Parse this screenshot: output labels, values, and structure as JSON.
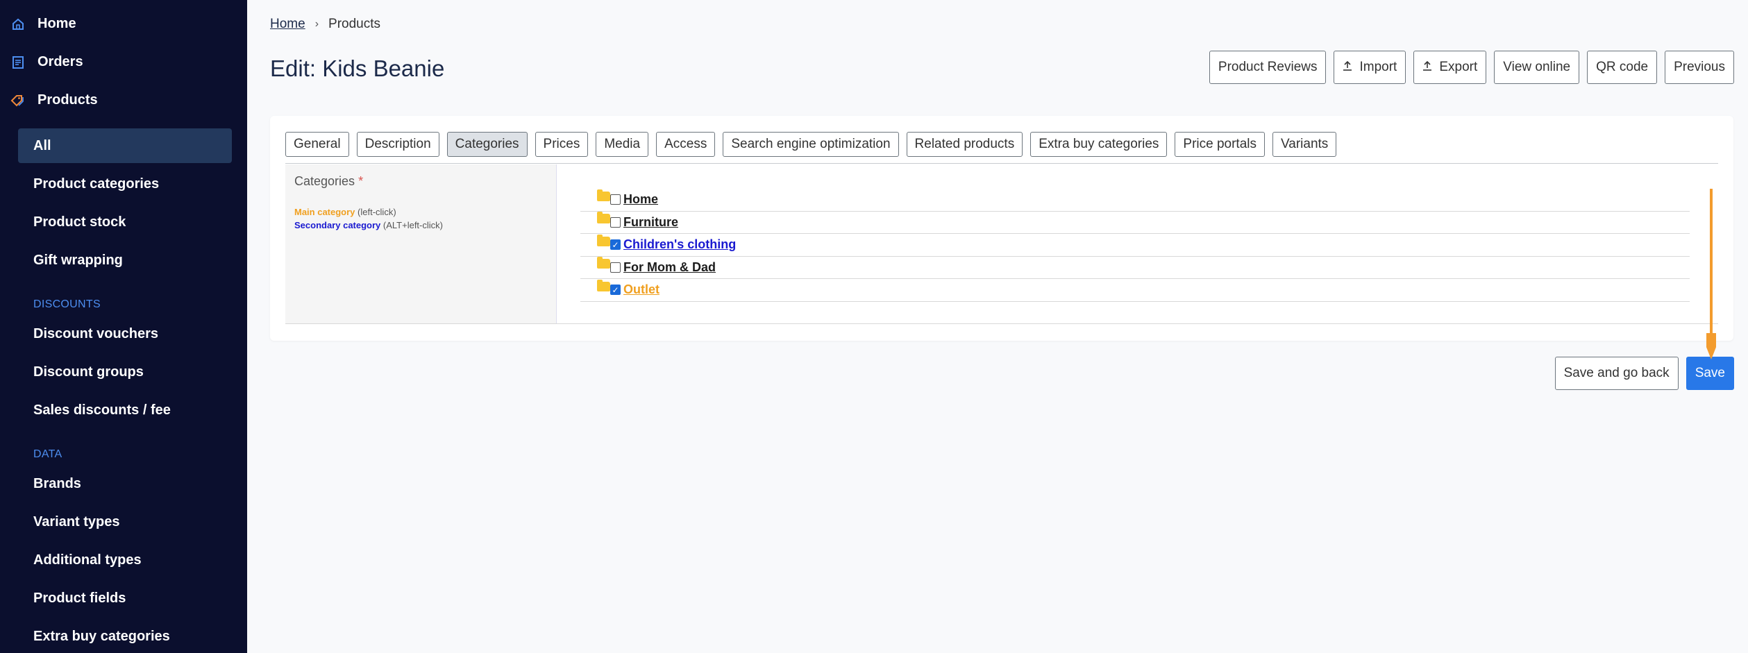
{
  "sidebar": {
    "top": [
      {
        "label": "Home",
        "icon": "home-icon"
      },
      {
        "label": "Orders",
        "icon": "orders-icon"
      },
      {
        "label": "Products",
        "icon": "tag-icon"
      }
    ],
    "products_sub": [
      "All",
      "Product categories",
      "Product stock",
      "Gift wrapping"
    ],
    "discounts_heading": "DISCOUNTS",
    "discounts": [
      "Discount vouchers",
      "Discount groups",
      "Sales discounts / fee"
    ],
    "data_heading": "DATA",
    "data": [
      "Brands",
      "Variant types",
      "Additional types",
      "Product fields",
      "Extra buy categories"
    ]
  },
  "breadcrumb": {
    "home": "Home",
    "separator": "›",
    "current": "Products"
  },
  "page_title": "Edit: Kids Beanie",
  "top_actions": [
    "Product Reviews",
    "Import",
    "Export",
    "View online",
    "QR code",
    "Previous"
  ],
  "tabs": [
    "General",
    "Description",
    "Categories",
    "Prices",
    "Media",
    "Access",
    "Search engine optimization",
    "Related products",
    "Extra buy categories",
    "Price portals",
    "Variants"
  ],
  "active_tab": "Categories",
  "categories_panel": {
    "label": "Categories",
    "required_mark": "*",
    "legend_main": "Main category",
    "legend_main_hint": "(left-click)",
    "legend_secondary": "Secondary category",
    "legend_secondary_hint": "(ALT+left-click)"
  },
  "tree": [
    {
      "label": "Home",
      "checked": false,
      "role": "none"
    },
    {
      "label": "Furniture",
      "checked": false,
      "role": "none"
    },
    {
      "label": "Children's clothing",
      "checked": true,
      "role": "secondary"
    },
    {
      "label": "For Mom & Dad",
      "checked": false,
      "role": "none"
    },
    {
      "label": "Outlet",
      "checked": true,
      "role": "main"
    }
  ],
  "bottom_actions": {
    "save_back": "Save and go back",
    "save": "Save"
  },
  "colors": {
    "sidebar_bg": "#0b0f2e",
    "accent": "#2878e8",
    "main_category": "#f0a020",
    "secondary_category": "#1a1ad0",
    "annotation_arrow": "#f39c2e"
  }
}
